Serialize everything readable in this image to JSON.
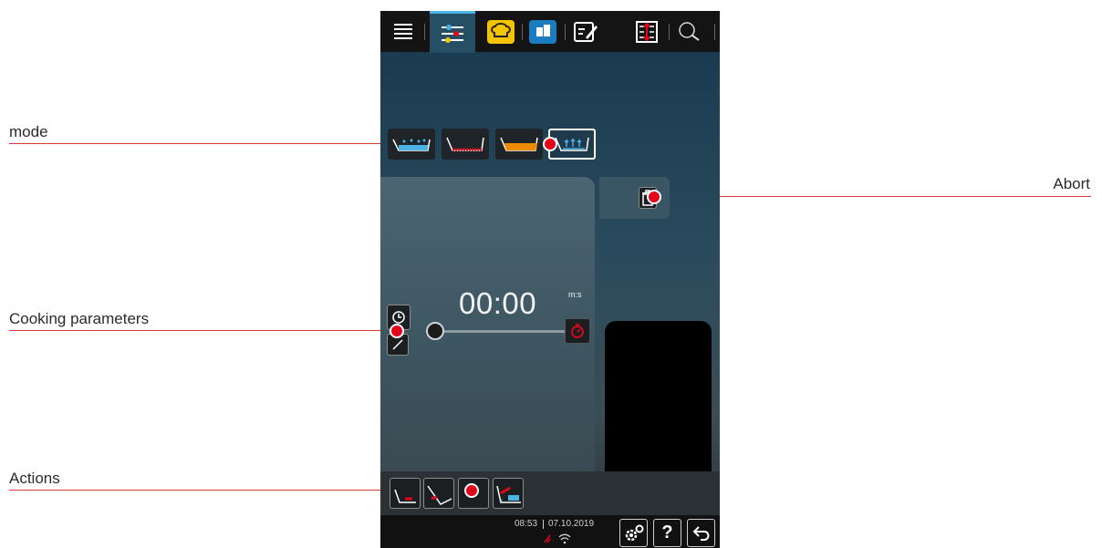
{
  "callouts": {
    "mode": "mode",
    "abort": "Abort",
    "cooking_parameters": "Cooking parameters",
    "actions": "Actions"
  },
  "topbar": {
    "tabs": [
      {
        "icon": "menu-lines-icon"
      },
      {
        "icon": "cooking-parameters-icon",
        "active": true
      },
      {
        "icon": "chef-hat-icon"
      },
      {
        "icon": "program-icon"
      },
      {
        "icon": "edit-icon"
      },
      {
        "icon": "temperature-icon"
      },
      {
        "icon": "search-icon"
      }
    ]
  },
  "modes": [
    {
      "icon": "mode-boil-icon"
    },
    {
      "icon": "mode-pan-heat-icon"
    },
    {
      "icon": "mode-fry-icon"
    },
    {
      "icon": "mode-steam-icon",
      "selected": true
    }
  ],
  "timer": {
    "value": "00:00",
    "unit": "m:s"
  },
  "status": {
    "time": "08:53",
    "date": "07.10.2019"
  },
  "help_label": "?",
  "colors": {
    "accent_red": "#e3061b",
    "active_tab": "#4bb3e6",
    "device_background": "#2a4b5d"
  }
}
